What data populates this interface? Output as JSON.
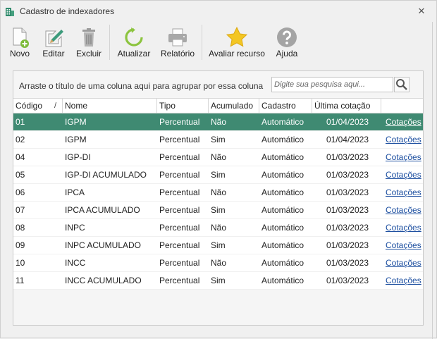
{
  "window": {
    "title": "Cadastro de indexadores",
    "close_glyph": "✕"
  },
  "toolbar": {
    "items": [
      {
        "label": "Novo",
        "icon": "new-document-icon"
      },
      {
        "label": "Editar",
        "icon": "edit-pencil-icon"
      },
      {
        "label": "Excluir",
        "icon": "trash-icon"
      },
      {
        "label": "Atualizar",
        "icon": "refresh-icon"
      },
      {
        "label": "Relatório",
        "icon": "printer-icon"
      },
      {
        "label": "Avaliar recurso",
        "icon": "star-icon"
      },
      {
        "label": "Ajuda",
        "icon": "help-icon"
      }
    ]
  },
  "grid": {
    "group_hint": "Arraste o título de uma coluna aqui para agrupar por essa coluna",
    "search_placeholder": "Digite sua pesquisa aqui...",
    "columns": [
      "Código",
      "Nome",
      "Tipo",
      "Acumulado",
      "Cadastro",
      "Última cotação",
      ""
    ],
    "sort_glyph": "/",
    "selected_row": 0,
    "rows": [
      [
        "01",
        "IGPM",
        "Percentual",
        "Não",
        "Automático",
        "01/04/2023",
        "Cotações"
      ],
      [
        "02",
        "IGPM",
        "Percentual",
        "Sim",
        "Automático",
        "01/04/2023",
        "Cotações"
      ],
      [
        "04",
        "IGP-DI",
        "Percentual",
        "Não",
        "Automático",
        "01/03/2023",
        "Cotações"
      ],
      [
        "05",
        "IGP-DI ACUMULADO",
        "Percentual",
        "Sim",
        "Automático",
        "01/03/2023",
        "Cotações"
      ],
      [
        "06",
        "IPCA",
        "Percentual",
        "Não",
        "Automático",
        "01/03/2023",
        "Cotações"
      ],
      [
        "07",
        "IPCA ACUMULADO",
        "Percentual",
        "Sim",
        "Automático",
        "01/03/2023",
        "Cotações"
      ],
      [
        "08",
        "INPC",
        "Percentual",
        "Não",
        "Automático",
        "01/03/2023",
        "Cotações"
      ],
      [
        "09",
        "INPC ACUMULADO",
        "Percentual",
        "Sim",
        "Automático",
        "01/03/2023",
        "Cotações"
      ],
      [
        "10",
        "INCC",
        "Percentual",
        "Não",
        "Automático",
        "01/03/2023",
        "Cotações"
      ],
      [
        "11",
        "INCC ACUMULADO",
        "Percentual",
        "Sim",
        "Automático",
        "01/03/2023",
        "Cotações"
      ]
    ]
  },
  "colors": {
    "selection": "#3f8a72",
    "link": "#1d4fa0",
    "accent_green": "#7dbb3a",
    "star": "#f3c623"
  }
}
